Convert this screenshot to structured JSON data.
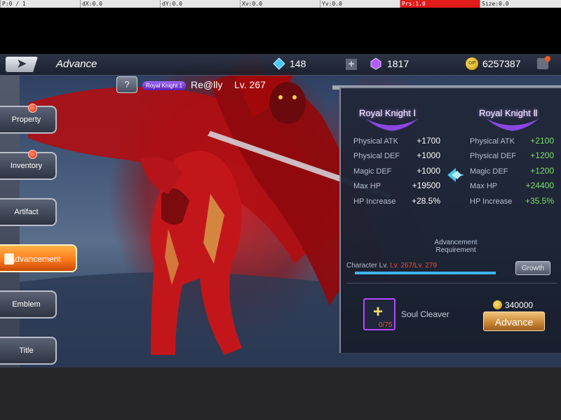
{
  "debug": {
    "cells": [
      "P:0 / 1",
      "dX:0.0",
      "dY:0.0",
      "Xv:0.0",
      "Yv:0.0",
      "Prs:1.0",
      "Size:0.0"
    ]
  },
  "header": {
    "title": "Advance",
    "gems": "148",
    "crystals": "1817",
    "gold": "6257387",
    "gold_icon_text": "GP"
  },
  "character": {
    "rank_badge": "Royal Knight 1",
    "name": "Re@lly",
    "level": "Lv. 267",
    "help_label": "?"
  },
  "menu": {
    "items": [
      {
        "label": "Property",
        "notify": true
      },
      {
        "label": "Inventory",
        "notify": true
      },
      {
        "label": "Artifact",
        "notify": false
      },
      {
        "label": "Advancement",
        "notify": false,
        "active": true
      },
      {
        "label": "Emblem",
        "notify": false
      },
      {
        "label": "Title",
        "notify": false
      }
    ]
  },
  "ranks": {
    "current": "Royal Knight Ⅰ",
    "next": "Royal Knight Ⅱ"
  },
  "stats": {
    "current": [
      {
        "name": "Physical ATK",
        "value": "+1700"
      },
      {
        "name": "Physical DEF",
        "value": "+1000"
      },
      {
        "name": "Magic DEF",
        "value": "+1000"
      },
      {
        "name": "Max HP",
        "value": "+19500"
      },
      {
        "name": "HP Increase",
        "value": "+28.5%"
      }
    ],
    "next": [
      {
        "name": "Physical ATK",
        "value": "+2100"
      },
      {
        "name": "Physical DEF",
        "value": "+1200"
      },
      {
        "name": "Magic DEF",
        "value": "+1200"
      },
      {
        "name": "Max HP",
        "value": "+24400"
      },
      {
        "name": "HP Increase",
        "value": "+35.5%"
      }
    ]
  },
  "requirement": {
    "title_line1": "Advancement",
    "title_line2": "Requirement",
    "char_lv_label": "Character Lv.",
    "char_lv_value": "Lv. 267/Lv. 279",
    "progress": 0.957,
    "growth_button": "Growth"
  },
  "material": {
    "name": "Soul Cleaver",
    "count": "0/75",
    "plus_glyph": "+"
  },
  "cost": {
    "gold": "340000",
    "advance_button": "Advance"
  },
  "colors": {
    "accent_orange": "#ff7a1a",
    "stat_green": "#7de06a",
    "requirement_red": "#e9503c",
    "progress_blue": "#3fb3ee",
    "item_border": "#b04bff"
  }
}
